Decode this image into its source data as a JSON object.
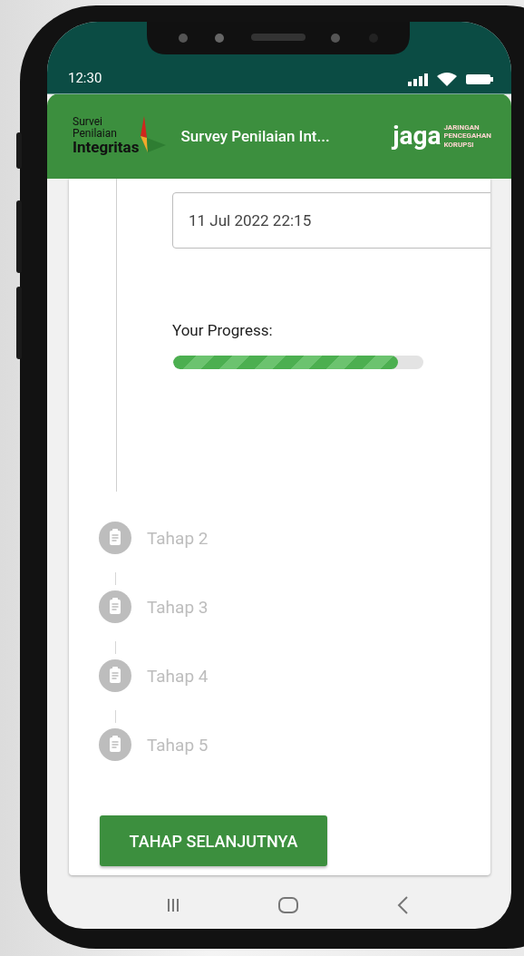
{
  "status_bar": {
    "time": "12:30"
  },
  "header": {
    "logo_lines": [
      "Survei",
      "Penilaian",
      "Integritas"
    ],
    "title": "Survey Penilaian Int...",
    "partner_logo": {
      "name": "jaga",
      "tagline": [
        "JARINGAN",
        "PENCEGAHAN",
        "KORUPSI"
      ]
    }
  },
  "current_step": {
    "date_field": {
      "value": "11 Jul 2022 22:15"
    },
    "progress_label": "Your Progress:",
    "progress": {
      "level": 0.9
    }
  },
  "steps": [
    {
      "label": "Tahap 2"
    },
    {
      "label": "Tahap 3"
    },
    {
      "label": "Tahap 4"
    },
    {
      "label": "Tahap 5"
    }
  ],
  "next_button": "TAHAP SELANJUTNYA"
}
